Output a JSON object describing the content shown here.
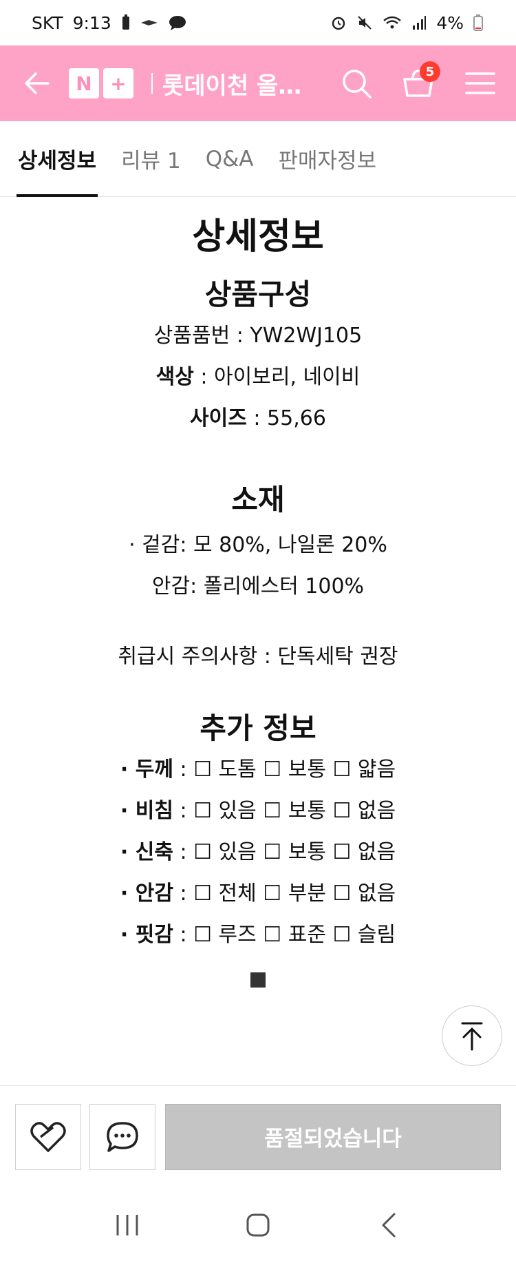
{
  "status_bar": {
    "carrier": "SKT",
    "time": "9:13",
    "battery": "4%"
  },
  "header": {
    "brand_n": "N",
    "brand_plus": "+",
    "title": "롯데이천 올…",
    "cart_count": "5"
  },
  "tabs": [
    {
      "label": "상세정보",
      "active": true
    },
    {
      "label": "리뷰 1",
      "active": false
    },
    {
      "label": "Q&A",
      "active": false
    },
    {
      "label": "판매자정보",
      "active": false
    }
  ],
  "detail": {
    "title": "상세정보",
    "composition_heading": "상품구성",
    "product_code_label": "상품품번",
    "product_code_value": " : YW2WJ105",
    "color_label": "색상",
    "color_value": " : 아이보리, 네이비",
    "size_label": "사이즈",
    "size_value": " : 55,66",
    "material_heading": "소재",
    "outer": "· 겉감: 모 80%, 나일론 20%",
    "lining": "안감: 폴리에스터 100%",
    "care": "취급시 주의사항 : 단독세탁 권장",
    "extra_heading": "추가 정보",
    "extra_rows": [
      {
        "label": "· 두께",
        "options": " : ☐ 도톰 ☐ 보통 ☐ 얇음"
      },
      {
        "label": "· 비침",
        "options": " : ☐ 있음 ☐ 보통 ☐ 없음"
      },
      {
        "label": "· 신축",
        "options": " : ☐ 있음 ☐ 보통 ☐ 없음"
      },
      {
        "label": "· 안감",
        "options": " : ☐ 전체 ☐ 부분 ☐ 없음"
      },
      {
        "label": "· 핏감",
        "options": " : ☐ 루즈 ☐ 표준 ☐ 슬림"
      }
    ]
  },
  "actions": {
    "soldout_label": "품절되었습니다"
  },
  "colors": {
    "header_bg": "#ffa3c6",
    "badge": "#ff3b30",
    "soldout_bg": "#c4c4c4"
  }
}
